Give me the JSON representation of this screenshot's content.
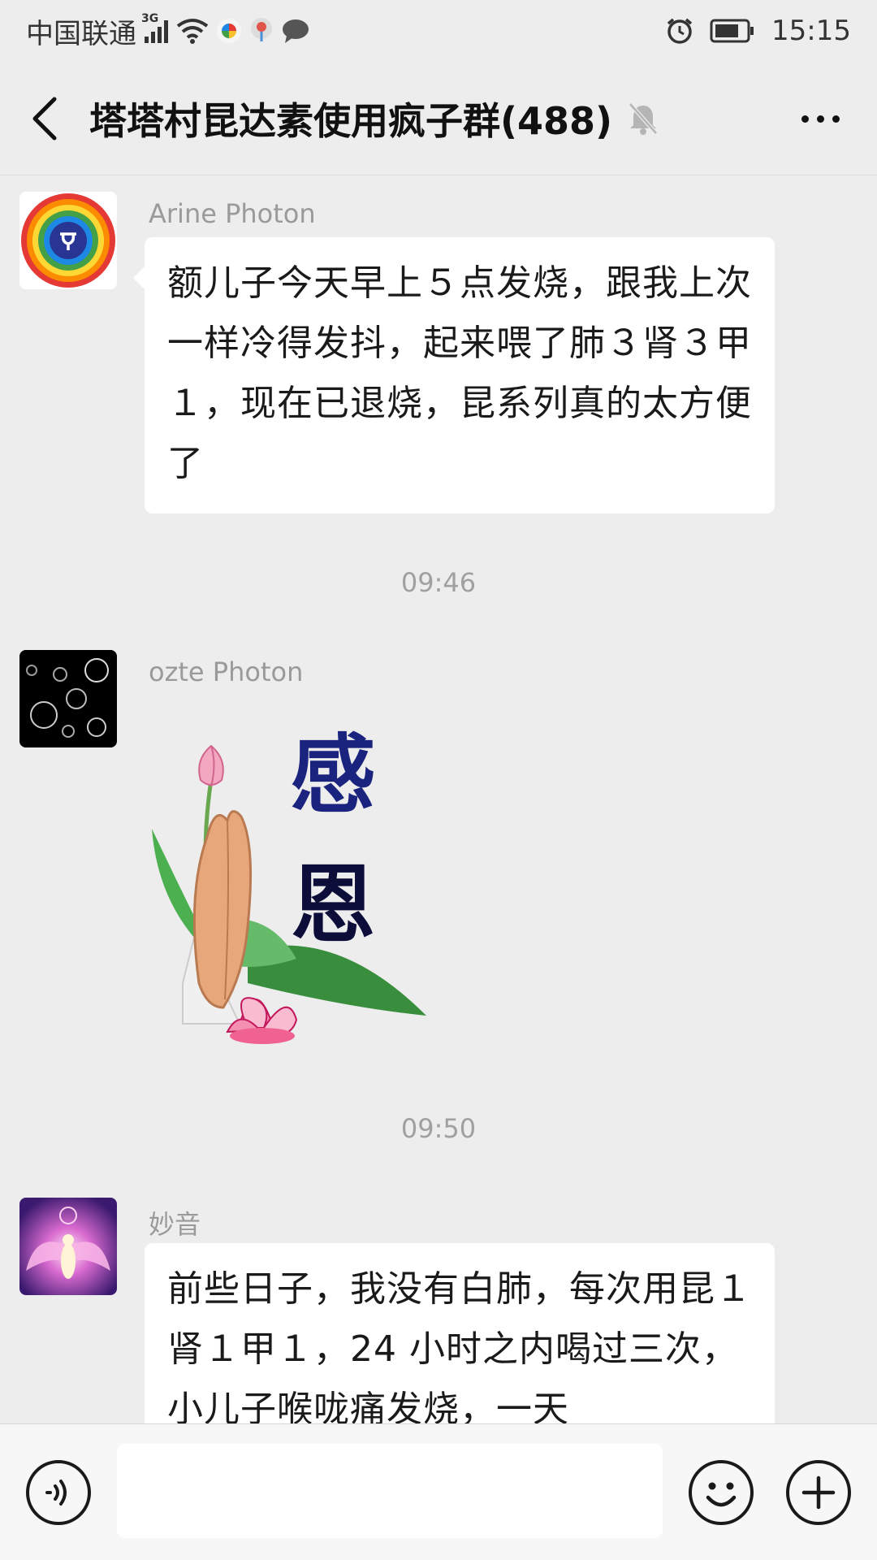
{
  "status_bar": {
    "carrier": "中国联通",
    "network_type": "3G",
    "time": "15:15",
    "icons": [
      "signal-icon",
      "wifi-icon",
      "app-notification-icon",
      "location-icon",
      "message-icon",
      "alarm-icon",
      "battery-icon"
    ]
  },
  "header": {
    "title": "塔塔村昆达素使用疯子群(488)",
    "icons": [
      "back-arrow-icon",
      "muted-bell-icon",
      "more-icon"
    ]
  },
  "messages": [
    {
      "sender": "Arine Photon",
      "avatar": "rainbow-circle-avatar",
      "text": "额儿子今天早上５点发烧，跟我上次一样冷得发抖，起来喂了肺３肾３甲１，现在已退烧，昆系列真的太方便了"
    },
    {
      "timestamp": "09:46"
    },
    {
      "sender": "ozte Photon",
      "avatar": "bubbles-avatar",
      "sticker": {
        "type": "praying-hands-lotus-sticker",
        "text": [
          "感",
          "恩"
        ]
      }
    },
    {
      "timestamp": "09:50"
    },
    {
      "sender": "妙音",
      "avatar": "angel-avatar",
      "text": "前些日子，我没有白肺，每次用昆１肾１甲１，24 小时之内喝过三次，小儿子喉咙痛发烧，一天"
    }
  ],
  "input_bar": {
    "placeholder": "",
    "icons": [
      "voice-icon",
      "emoji-icon",
      "plus-icon"
    ]
  }
}
